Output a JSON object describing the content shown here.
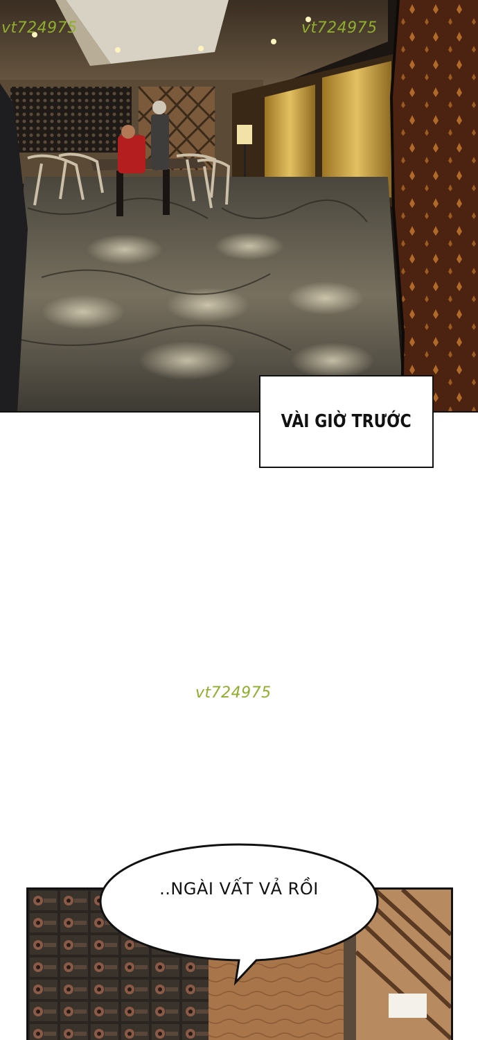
{
  "watermarks": {
    "top_left": "vt724975",
    "top_right": "vt724975",
    "middle": "vt724975"
  },
  "caption": {
    "text": "VÀI GIỜ TRƯỚC"
  },
  "speech_bubble": {
    "text": "..NGÀI VẤT VẢ RỒI"
  },
  "colors": {
    "floor": "#5f5a4f",
    "wall_gold": "#c9a03c",
    "curtain": "#5a2a14",
    "wine_rack": "#2a2520",
    "wood": "#a8744a",
    "watermark": "#8fae2e"
  }
}
